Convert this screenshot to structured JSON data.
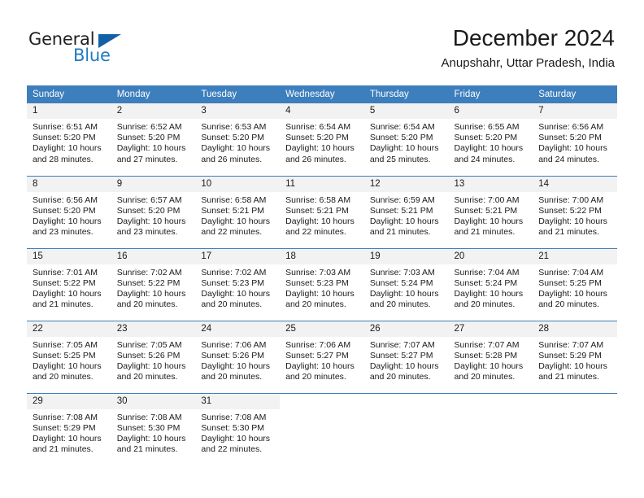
{
  "logo": {
    "word_one": "General",
    "word_two": "Blue",
    "flag_icon": "triangle-flag-icon"
  },
  "header": {
    "title": "December 2024",
    "subtitle": "Anupshahr, Uttar Pradesh, India"
  },
  "colors": {
    "header_blue": "#3d7ebd",
    "logo_blue": "#1f7bc1",
    "flag_blue": "#1360a8",
    "daynum_bg": "#f2f2f2",
    "text": "#1a1a1a"
  },
  "weekday_headers": [
    "Sunday",
    "Monday",
    "Tuesday",
    "Wednesday",
    "Thursday",
    "Friday",
    "Saturday"
  ],
  "labels": {
    "sunrise_prefix": "Sunrise: ",
    "sunset_prefix": "Sunset: ",
    "daylight_prefix": "Daylight: "
  },
  "weeks": [
    [
      {
        "day": "1",
        "sunrise": "Sunrise: 6:51 AM",
        "sunset": "Sunset: 5:20 PM",
        "daylight": "Daylight: 10 hours and 28 minutes."
      },
      {
        "day": "2",
        "sunrise": "Sunrise: 6:52 AM",
        "sunset": "Sunset: 5:20 PM",
        "daylight": "Daylight: 10 hours and 27 minutes."
      },
      {
        "day": "3",
        "sunrise": "Sunrise: 6:53 AM",
        "sunset": "Sunset: 5:20 PM",
        "daylight": "Daylight: 10 hours and 26 minutes."
      },
      {
        "day": "4",
        "sunrise": "Sunrise: 6:54 AM",
        "sunset": "Sunset: 5:20 PM",
        "daylight": "Daylight: 10 hours and 26 minutes."
      },
      {
        "day": "5",
        "sunrise": "Sunrise: 6:54 AM",
        "sunset": "Sunset: 5:20 PM",
        "daylight": "Daylight: 10 hours and 25 minutes."
      },
      {
        "day": "6",
        "sunrise": "Sunrise: 6:55 AM",
        "sunset": "Sunset: 5:20 PM",
        "daylight": "Daylight: 10 hours and 24 minutes."
      },
      {
        "day": "7",
        "sunrise": "Sunrise: 6:56 AM",
        "sunset": "Sunset: 5:20 PM",
        "daylight": "Daylight: 10 hours and 24 minutes."
      }
    ],
    [
      {
        "day": "8",
        "sunrise": "Sunrise: 6:56 AM",
        "sunset": "Sunset: 5:20 PM",
        "daylight": "Daylight: 10 hours and 23 minutes."
      },
      {
        "day": "9",
        "sunrise": "Sunrise: 6:57 AM",
        "sunset": "Sunset: 5:20 PM",
        "daylight": "Daylight: 10 hours and 23 minutes."
      },
      {
        "day": "10",
        "sunrise": "Sunrise: 6:58 AM",
        "sunset": "Sunset: 5:21 PM",
        "daylight": "Daylight: 10 hours and 22 minutes."
      },
      {
        "day": "11",
        "sunrise": "Sunrise: 6:58 AM",
        "sunset": "Sunset: 5:21 PM",
        "daylight": "Daylight: 10 hours and 22 minutes."
      },
      {
        "day": "12",
        "sunrise": "Sunrise: 6:59 AM",
        "sunset": "Sunset: 5:21 PM",
        "daylight": "Daylight: 10 hours and 21 minutes."
      },
      {
        "day": "13",
        "sunrise": "Sunrise: 7:00 AM",
        "sunset": "Sunset: 5:21 PM",
        "daylight": "Daylight: 10 hours and 21 minutes."
      },
      {
        "day": "14",
        "sunrise": "Sunrise: 7:00 AM",
        "sunset": "Sunset: 5:22 PM",
        "daylight": "Daylight: 10 hours and 21 minutes."
      }
    ],
    [
      {
        "day": "15",
        "sunrise": "Sunrise: 7:01 AM",
        "sunset": "Sunset: 5:22 PM",
        "daylight": "Daylight: 10 hours and 21 minutes."
      },
      {
        "day": "16",
        "sunrise": "Sunrise: 7:02 AM",
        "sunset": "Sunset: 5:22 PM",
        "daylight": "Daylight: 10 hours and 20 minutes."
      },
      {
        "day": "17",
        "sunrise": "Sunrise: 7:02 AM",
        "sunset": "Sunset: 5:23 PM",
        "daylight": "Daylight: 10 hours and 20 minutes."
      },
      {
        "day": "18",
        "sunrise": "Sunrise: 7:03 AM",
        "sunset": "Sunset: 5:23 PM",
        "daylight": "Daylight: 10 hours and 20 minutes."
      },
      {
        "day": "19",
        "sunrise": "Sunrise: 7:03 AM",
        "sunset": "Sunset: 5:24 PM",
        "daylight": "Daylight: 10 hours and 20 minutes."
      },
      {
        "day": "20",
        "sunrise": "Sunrise: 7:04 AM",
        "sunset": "Sunset: 5:24 PM",
        "daylight": "Daylight: 10 hours and 20 minutes."
      },
      {
        "day": "21",
        "sunrise": "Sunrise: 7:04 AM",
        "sunset": "Sunset: 5:25 PM",
        "daylight": "Daylight: 10 hours and 20 minutes."
      }
    ],
    [
      {
        "day": "22",
        "sunrise": "Sunrise: 7:05 AM",
        "sunset": "Sunset: 5:25 PM",
        "daylight": "Daylight: 10 hours and 20 minutes."
      },
      {
        "day": "23",
        "sunrise": "Sunrise: 7:05 AM",
        "sunset": "Sunset: 5:26 PM",
        "daylight": "Daylight: 10 hours and 20 minutes."
      },
      {
        "day": "24",
        "sunrise": "Sunrise: 7:06 AM",
        "sunset": "Sunset: 5:26 PM",
        "daylight": "Daylight: 10 hours and 20 minutes."
      },
      {
        "day": "25",
        "sunrise": "Sunrise: 7:06 AM",
        "sunset": "Sunset: 5:27 PM",
        "daylight": "Daylight: 10 hours and 20 minutes."
      },
      {
        "day": "26",
        "sunrise": "Sunrise: 7:07 AM",
        "sunset": "Sunset: 5:27 PM",
        "daylight": "Daylight: 10 hours and 20 minutes."
      },
      {
        "day": "27",
        "sunrise": "Sunrise: 7:07 AM",
        "sunset": "Sunset: 5:28 PM",
        "daylight": "Daylight: 10 hours and 20 minutes."
      },
      {
        "day": "28",
        "sunrise": "Sunrise: 7:07 AM",
        "sunset": "Sunset: 5:29 PM",
        "daylight": "Daylight: 10 hours and 21 minutes."
      }
    ],
    [
      {
        "day": "29",
        "sunrise": "Sunrise: 7:08 AM",
        "sunset": "Sunset: 5:29 PM",
        "daylight": "Daylight: 10 hours and 21 minutes."
      },
      {
        "day": "30",
        "sunrise": "Sunrise: 7:08 AM",
        "sunset": "Sunset: 5:30 PM",
        "daylight": "Daylight: 10 hours and 21 minutes."
      },
      {
        "day": "31",
        "sunrise": "Sunrise: 7:08 AM",
        "sunset": "Sunset: 5:30 PM",
        "daylight": "Daylight: 10 hours and 22 minutes."
      },
      {
        "day": "",
        "sunrise": "",
        "sunset": "",
        "daylight": ""
      },
      {
        "day": "",
        "sunrise": "",
        "sunset": "",
        "daylight": ""
      },
      {
        "day": "",
        "sunrise": "",
        "sunset": "",
        "daylight": ""
      },
      {
        "day": "",
        "sunrise": "",
        "sunset": "",
        "daylight": ""
      }
    ]
  ]
}
